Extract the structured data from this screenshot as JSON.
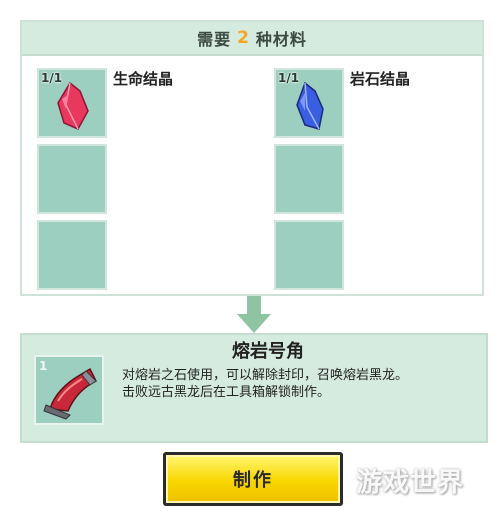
{
  "materials": {
    "header_prefix": "需要",
    "header_count": "2",
    "header_suffix": "种材料",
    "items": [
      {
        "qty": "1/1",
        "name": "生命结晶",
        "icon": "red-crystal-icon",
        "color": "#e8385e"
      },
      {
        "qty": "1/1",
        "name": "岩石结晶",
        "icon": "blue-crystal-icon",
        "color": "#3a5ee0"
      }
    ]
  },
  "result": {
    "qty": "1",
    "name": "熔岩号角",
    "icon": "lava-horn-icon",
    "description_line1": "对熔岩之石使用，可以解除封印，召唤熔岩黑龙。",
    "description_line2": "击败远古黑龙后在工具箱解锁制作。"
  },
  "craft_button": {
    "label": "制作"
  },
  "watermark": {
    "text": "游戏世界"
  },
  "colors": {
    "slot_bg": "#9ccfc0",
    "panel_bg": "#d6ebdf",
    "accent_count": "#f5a623",
    "button_yellow": "#f8d600"
  }
}
